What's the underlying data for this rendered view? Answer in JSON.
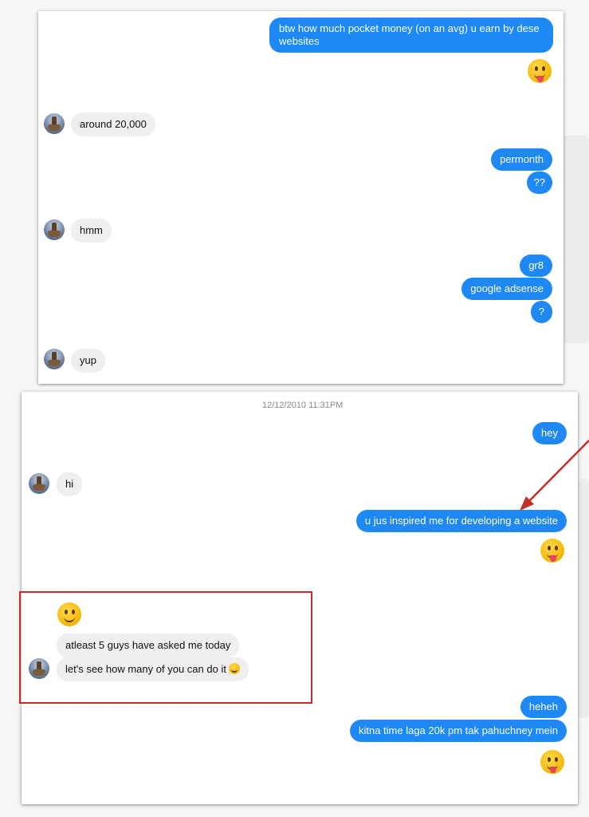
{
  "panel1": {
    "messages": [
      {
        "dir": "out",
        "text": "btw how much pocket money (on an avg) u earn by dese websites"
      },
      {
        "dir": "out",
        "emoji": "tongue-face-emoji"
      },
      {
        "dir": "in",
        "text": "around 20,000"
      },
      {
        "dir": "out",
        "text": "permonth"
      },
      {
        "dir": "out",
        "text": "??"
      },
      {
        "dir": "in",
        "text": "hmm"
      },
      {
        "dir": "out",
        "text": "gr8"
      },
      {
        "dir": "out",
        "text": "google adsense"
      },
      {
        "dir": "out",
        "text": "?"
      },
      {
        "dir": "in",
        "text": "yup"
      }
    ]
  },
  "panel2": {
    "timestamp": "12/12/2010 11:31PM",
    "messages": [
      {
        "dir": "out",
        "text": "hey"
      },
      {
        "dir": "in",
        "text": "hi"
      },
      {
        "dir": "out",
        "text": "u jus inspired me for developing a website"
      },
      {
        "dir": "out",
        "emoji": "tongue-face-emoji"
      },
      {
        "dir": "in",
        "emoji": "smile-face-emoji"
      },
      {
        "dir": "in",
        "text": "atleast 5 guys have asked me today"
      },
      {
        "dir": "in",
        "text": "let's see how many of you can do it",
        "emoji": "grin-emoji"
      },
      {
        "dir": "out",
        "text": "heheh"
      },
      {
        "dir": "out",
        "text": "kitna time laga 20k pm tak pahuchney mein"
      },
      {
        "dir": "out",
        "emoji": "tongue-face-emoji"
      }
    ]
  },
  "colors": {
    "outgoing_bubble": "#1e88f5",
    "incoming_bubble": "#efefef",
    "annotation": "#c0302a"
  }
}
